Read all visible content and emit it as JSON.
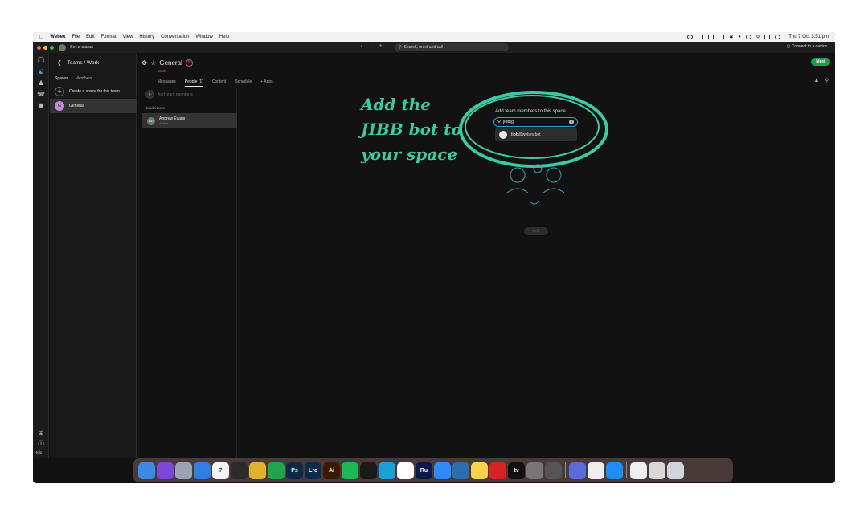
{
  "menubar": {
    "app": "Webex",
    "items": [
      "File",
      "Edit",
      "Format",
      "View",
      "History",
      "Conversation",
      "Window",
      "Help"
    ],
    "clock": "Thu 7 Oct 3:51 pm"
  },
  "titlebar": {
    "status": "Set a status",
    "search_placeholder": "Search, meet and call",
    "connect": "Connect to a device"
  },
  "sidebar": {
    "title": "Teams / Work",
    "tabs": [
      "Spaces",
      "Members"
    ],
    "create_label": "Create a space for this team",
    "items": [
      {
        "label": "General",
        "initial": "G"
      }
    ]
  },
  "header": {
    "space_title": "General",
    "team_name": "Work",
    "tabs": [
      "Messages",
      "People (1)",
      "Content",
      "Schedule",
      "+  Apps"
    ],
    "meet_label": "Meet"
  },
  "people": {
    "add_label": "Add team members",
    "section": "Moderators",
    "members": [
      {
        "name": "Andrew Evans",
        "status": "Active",
        "initials": "AE"
      }
    ]
  },
  "dialog": {
    "title": "Add team members to this space",
    "input_value": "jibb@",
    "result_bold": "jibb@",
    "result_rest": "webex.bot",
    "add_label": "Add"
  },
  "annotation": "Add the\nJIBB bot to\nyour space",
  "rail": {
    "help": "Help"
  },
  "dock": [
    {
      "name": "finder",
      "label": "",
      "color": "#3d8be0"
    },
    {
      "name": "siri",
      "label": "",
      "color": "#7b46d9"
    },
    {
      "name": "launchpad",
      "label": "",
      "color": "#9aa3b5"
    },
    {
      "name": "mail",
      "label": "",
      "color": "#2f7fe0"
    },
    {
      "name": "calendar",
      "label": "7",
      "color": "#f2f2f2"
    },
    {
      "name": "figma",
      "label": "",
      "color": "#2b2b2b"
    },
    {
      "name": "chrome",
      "label": "",
      "color": "#e0b02f"
    },
    {
      "name": "trello",
      "label": "",
      "color": "#1fa54a"
    },
    {
      "name": "photoshop",
      "label": "Ps",
      "color": "#0c2a4a"
    },
    {
      "name": "lightroom",
      "label": "Lrc",
      "color": "#0c2a4a"
    },
    {
      "name": "illustrator",
      "label": "Ai",
      "color": "#3a1a00"
    },
    {
      "name": "spotify",
      "label": "",
      "color": "#1db954"
    },
    {
      "name": "webex",
      "label": "",
      "color": "#1a1a1a"
    },
    {
      "name": "screen",
      "label": "",
      "color": "#1aa0d9"
    },
    {
      "name": "slack",
      "label": "",
      "color": "#ffffff"
    },
    {
      "name": "rush",
      "label": "Ru",
      "color": "#0b1a4a"
    },
    {
      "name": "zoom",
      "label": "",
      "color": "#2d8cff"
    },
    {
      "name": "quicktime",
      "label": "",
      "color": "#2a6fb0"
    },
    {
      "name": "notes",
      "label": "",
      "color": "#f7d24a"
    },
    {
      "name": "acrobat",
      "label": "",
      "color": "#d9231f"
    },
    {
      "name": "appletv",
      "label": "tv",
      "color": "#111111"
    },
    {
      "name": "settings",
      "label": "",
      "color": "#777777"
    },
    {
      "name": "calculator",
      "label": "",
      "color": "#555555"
    },
    {
      "name": "sep",
      "label": "",
      "color": ""
    },
    {
      "name": "spark",
      "label": "",
      "color": "#5a6bd9"
    },
    {
      "name": "textedit",
      "label": "",
      "color": "#eeeeee"
    },
    {
      "name": "appstore",
      "label": "",
      "color": "#1f8df2"
    },
    {
      "name": "sep",
      "label": "",
      "color": ""
    },
    {
      "name": "document",
      "label": "",
      "color": "#f0f0f0"
    },
    {
      "name": "downloads",
      "label": "",
      "color": "#d8d8d8"
    },
    {
      "name": "trash",
      "label": "",
      "color": "#cfd5da"
    }
  ]
}
